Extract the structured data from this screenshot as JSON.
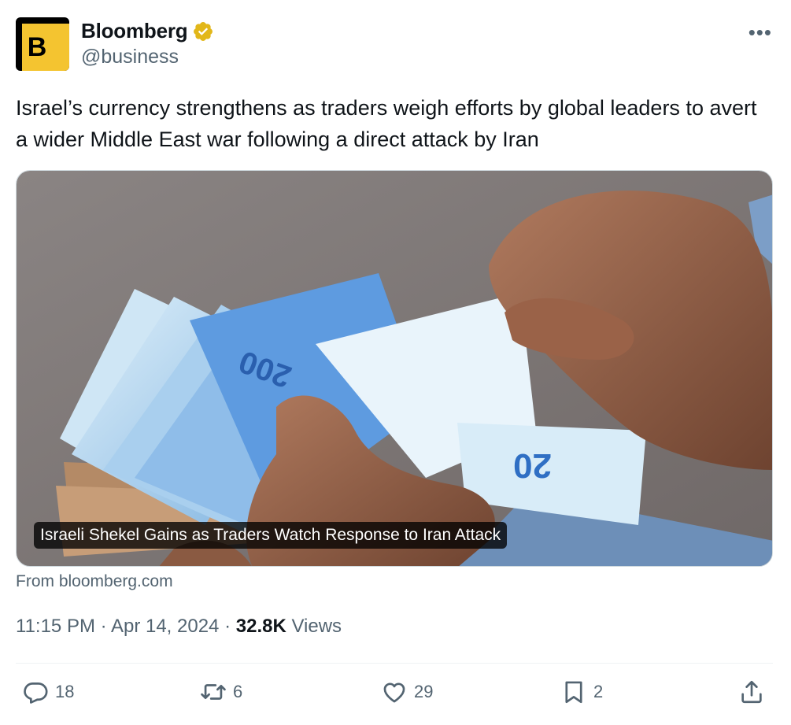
{
  "author": {
    "avatar_letter": "B",
    "name": "Bloomberg",
    "handle": "@business",
    "verified_icon": "gold-verified-badge",
    "brand_color": "#f4c430"
  },
  "more_label": "•••",
  "tweet": {
    "text": "Israel’s currency strengthens as traders weigh efforts by global leaders to avert a wider Middle East war following a direct attack by Iran"
  },
  "card": {
    "image_description_icon": "shekel-banknotes-photo",
    "headline": "Israeli Shekel Gains as Traders Watch Response to Iran Attack",
    "source": "From bloomberg.com"
  },
  "meta": {
    "time": "11:15 PM",
    "separator": "·",
    "date": "Apr 14, 2024",
    "views_count": "32.8K",
    "views_label": "Views"
  },
  "actions": {
    "replies": "18",
    "retweets": "6",
    "likes": "29",
    "bookmarks": "2"
  },
  "colors": {
    "text_primary": "#0f1419",
    "text_secondary": "#536471",
    "divider": "#eff3f4"
  }
}
